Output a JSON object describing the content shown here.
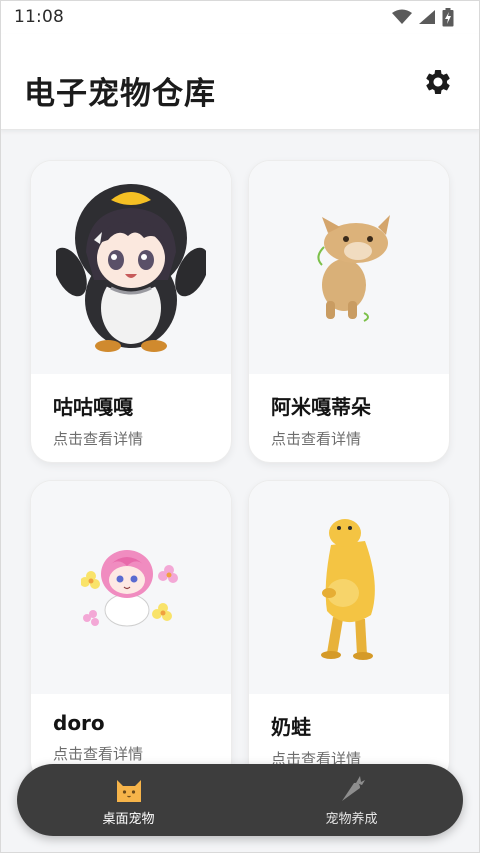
{
  "status_bar": {
    "time": "11:08",
    "icons": [
      "wifi-icon",
      "signal-icon",
      "battery-charging-icon"
    ]
  },
  "app_bar": {
    "title": "电子宠物仓库",
    "settings_icon": "gear-icon"
  },
  "pets": [
    {
      "name": "咕咕嘎嘎",
      "subtitle": "点击查看详情",
      "image": "penguin-hood-girl-sticker"
    },
    {
      "name": "阿米嘎蒂朵",
      "subtitle": "点击查看详情",
      "image": "dancing-cat-sticker"
    },
    {
      "name": "doro",
      "subtitle": "点击查看详情",
      "image": "pink-hair-doro-sticker"
    },
    {
      "name": "奶蛙",
      "subtitle": "点击查看详情",
      "image": "yellow-frog-sticker"
    }
  ],
  "bottom_nav": {
    "items": [
      {
        "label": "桌面宠物",
        "icon": "cat-face-icon",
        "active": true
      },
      {
        "label": "宠物养成",
        "icon": "carrot-icon",
        "active": false
      }
    ]
  },
  "colors": {
    "background": "#f4f5f7",
    "card": "#ffffff",
    "nav_bg": "#3d3d3d",
    "cat_icon": "#f6b44a"
  }
}
